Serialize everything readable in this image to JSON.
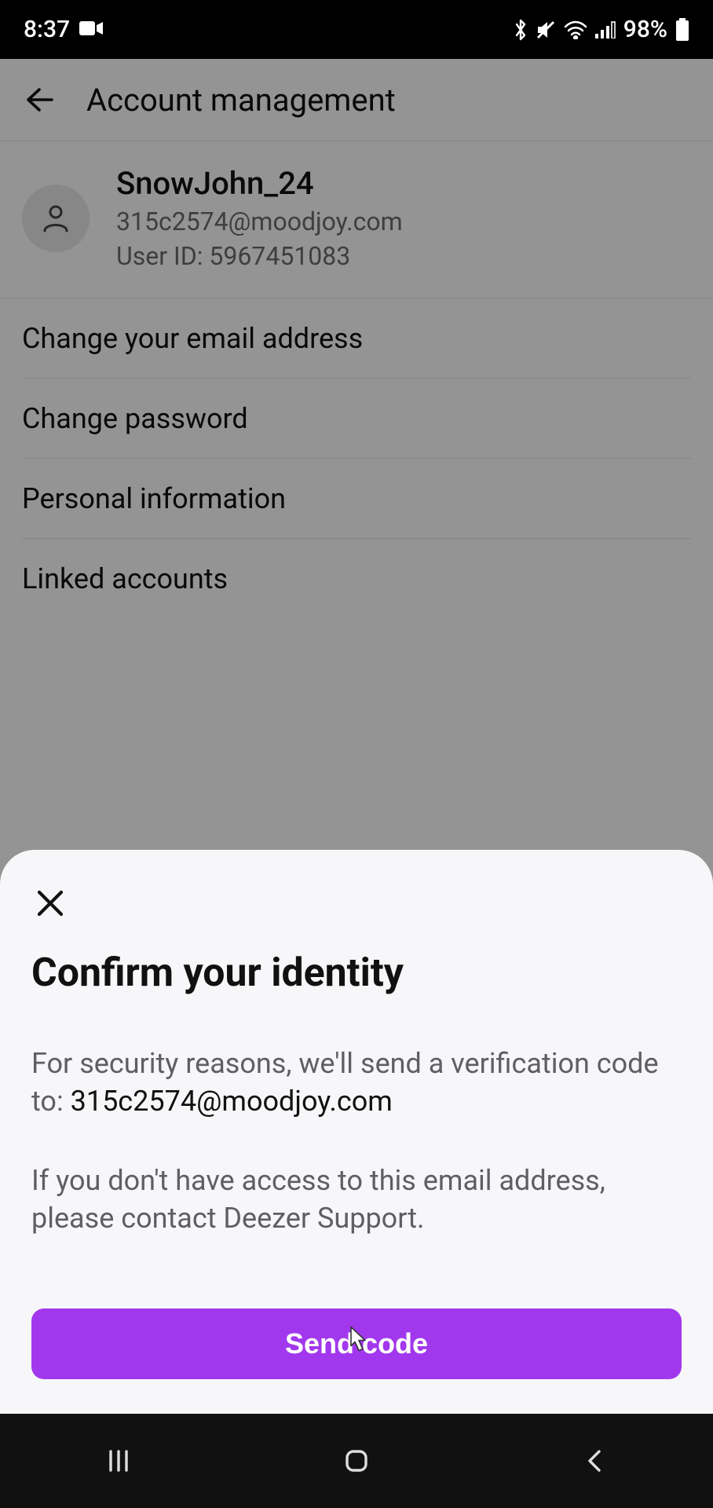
{
  "status": {
    "time": "8:37",
    "battery_pct": "98%"
  },
  "header": {
    "title": "Account management"
  },
  "profile": {
    "name": "SnowJohn_24",
    "email": "315c2574@moodjoy.com",
    "user_id_label": "User ID: ",
    "user_id": "5967451083"
  },
  "menu": {
    "items": [
      "Change your email address",
      "Change password",
      "Personal information",
      "Linked accounts"
    ]
  },
  "modal": {
    "title": "Confirm your identity",
    "line1_prefix": "For security reasons, we'll send a verification code to: ",
    "email": "315c2574@moodjoy.com",
    "line2": "If you don't have access to this email address, please contact Deezer Support.",
    "button": "Send code"
  }
}
